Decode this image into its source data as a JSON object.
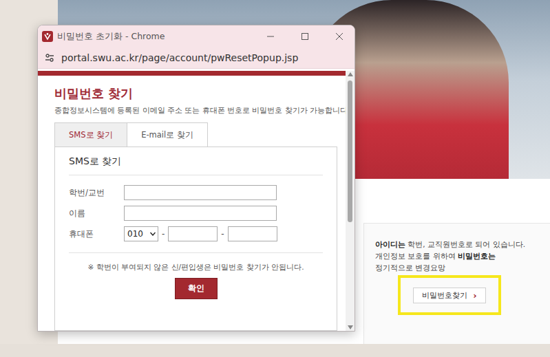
{
  "popup": {
    "title": "비밀번호 초기화 - Chrome",
    "url": "portal.swu.ac.kr/page/account/pwResetPopup.jsp",
    "heading": "비밀번호 찾기",
    "description": "종합정보시스템에 등록된 이메일 주소 또는 휴대폰 번호로 비밀번호 찾기가 가능합니다.",
    "tabs": [
      {
        "label": "SMS로 찾기",
        "selected": true
      },
      {
        "label": "E-mail로 찾기",
        "selected": false
      }
    ],
    "section_title": "SMS로 찾기",
    "fields": [
      {
        "label": "학번/교번",
        "kind": "text"
      },
      {
        "label": "이름",
        "kind": "text"
      },
      {
        "label": "휴대폰",
        "kind": "phone",
        "prefix": "010",
        "separator": "-"
      }
    ],
    "note": "※ 학번이 부여되지 않은 신/편입생은 비밀번호 찾기가 안됩니다.",
    "confirm_button": "확인"
  },
  "page": {
    "notice": [
      [
        {
          "text": "아이디는",
          "bold": true
        },
        {
          "text": " 학번, 교직원번호로 되어 있습니다.",
          "bold": false
        }
      ],
      [
        {
          "text": "개인정보 보호를 위하여 ",
          "bold": false
        },
        {
          "text": "비밀번호는",
          "bold": true
        }
      ],
      [
        {
          "text": "정기적으로 변경요망",
          "bold": false
        }
      ]
    ],
    "find_password_button": {
      "label": "비밀번호찾기",
      "icon": "›",
      "highlighted": true
    }
  }
}
